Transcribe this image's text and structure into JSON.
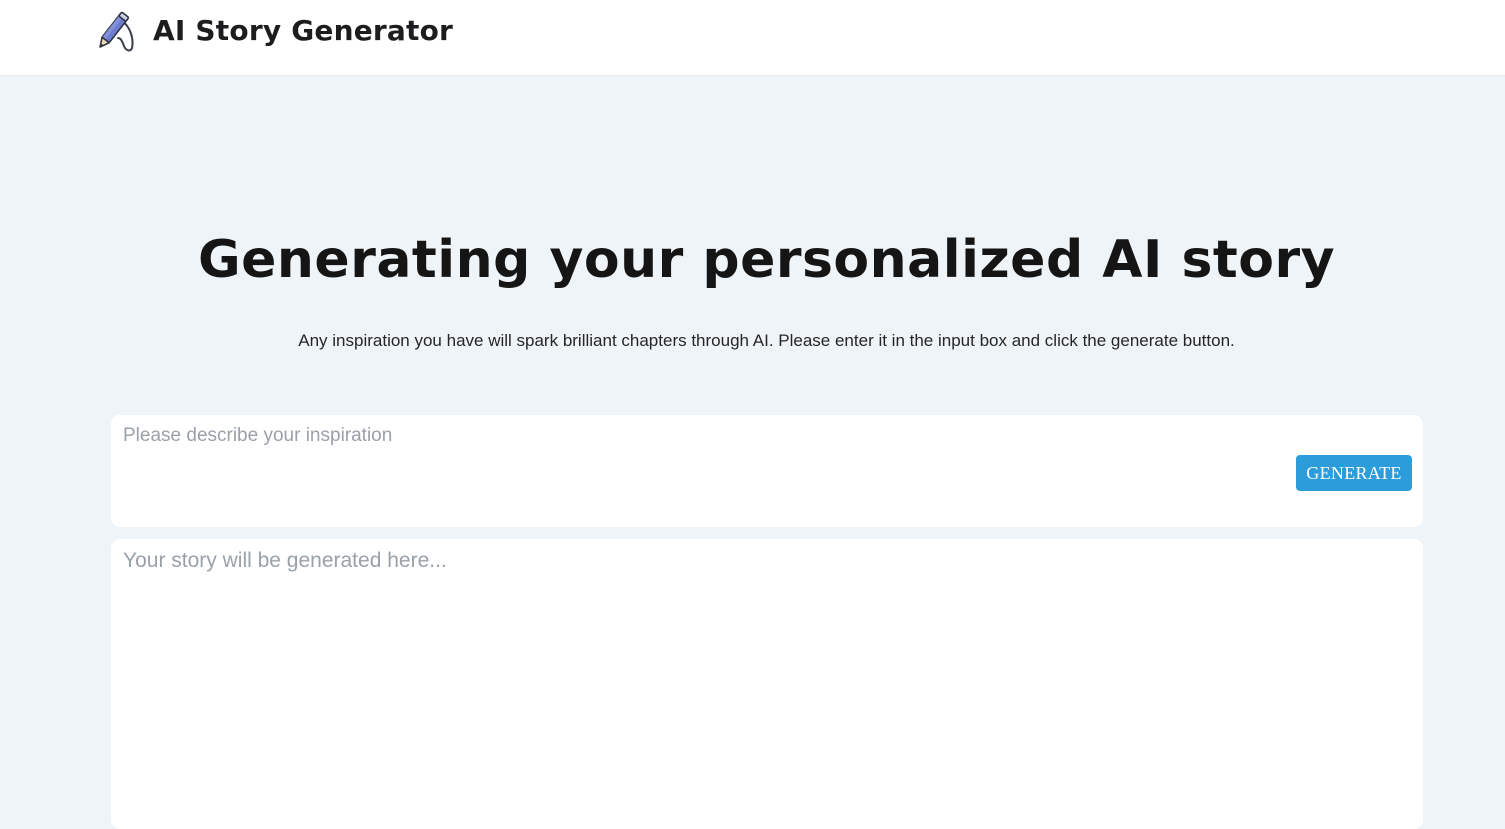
{
  "header": {
    "title": "AI Story Generator",
    "logo_icon": "pen-icon"
  },
  "hero": {
    "headline": "Generating your personalized AI story",
    "subtext": "Any inspiration you have will spark brilliant chapters through AI. Please enter it in the input box and click the generate button."
  },
  "input": {
    "value": "",
    "placeholder": "Please describe your inspiration",
    "generate_label": "GENERATE"
  },
  "output": {
    "value": "",
    "placeholder": "Your story will be generated here..."
  },
  "colors": {
    "background": "#eff4f8",
    "accent": "#2d9cdb",
    "card": "#ffffff"
  }
}
